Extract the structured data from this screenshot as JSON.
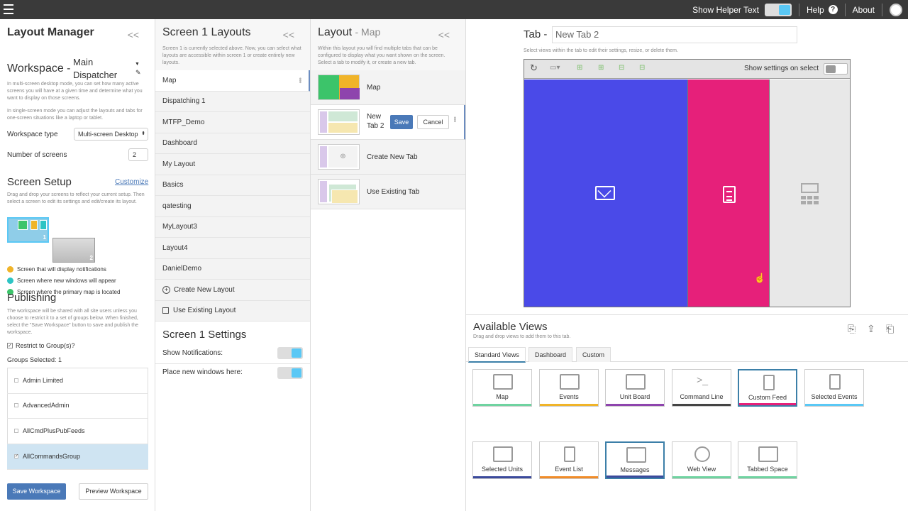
{
  "topbar": {
    "helper_label": "Show Helper Text",
    "help_label": "Help",
    "about_label": "About"
  },
  "layout_manager": {
    "title": "Layout Manager",
    "workspace_label": "Workspace -",
    "workspace_name": "Main Dispatcher",
    "desc1": "In multi-screen desktop mode, you can set how many active screens you will have at a given time and determine what you want to display on those screens.",
    "desc2": "In single-screen mode you can adjust the layouts and tabs for one-screen situations like a laptop or tablet.",
    "workspace_type_label": "Workspace type",
    "workspace_type_value": "Multi-screen Desktop",
    "num_screens_label": "Number of screens",
    "num_screens_value": "2",
    "screen_setup_title": "Screen Setup",
    "customize_label": "Customize",
    "screen_setup_desc": "Drag and drop your screens to reflect your current setup. Then select a screen to edit its settings and edit/create its layout.",
    "screen1_num": "1",
    "screen2_num": "2",
    "legend": [
      {
        "label": "Screen that will display notifications",
        "color": "#f0b429"
      },
      {
        "label": "Screen where new windows will appear",
        "color": "#2ec4c4"
      },
      {
        "label": "Screen where the primary map is located",
        "color": "#3cc46a"
      }
    ],
    "publishing_title": "Publishing",
    "publishing_desc": "The workspace will be shared with all site users unless you choose to restrict it to a set of groups below. When finished, select the \"Save Workspace\" button to save and publish the workspace.",
    "restrict_label": "Restrict to Group(s)?",
    "groups_selected_label": "Groups Selected: 1",
    "groups": [
      "Admin Limited",
      "AdvancedAdmin",
      "AllCmdPlusPubFeeds",
      "AllCommandsGroup"
    ],
    "save_label": "Save Workspace",
    "preview_label": "Preview Workspace"
  },
  "screen_layouts": {
    "title": "Screen 1 Layouts",
    "desc": "Screen 1 is currently selected above. Now, you can select what layouts are accessible within screen 1 or create entirely new layouts.",
    "items": [
      "Map",
      "Dispatching 1",
      "MTFP_Demo",
      "Dashboard",
      "My Layout",
      "Basics",
      "qatesting",
      "MyLayout3",
      "Layout4",
      "DanielDemo"
    ],
    "create_label": "Create New Layout",
    "use_existing_label": "Use Existing Layout",
    "settings_title": "Screen 1 Settings",
    "show_notifications_label": "Show Notifications:",
    "place_windows_label": "Place new windows here:"
  },
  "layout_map": {
    "title": "Layout",
    "subtitle": "- Map",
    "desc": "Within this layout you will find multiple tabs that can be configured to display what you want shown on the screen. Select a tab to modify it, or create a new tab.",
    "tab_map_label": "Map",
    "tab_new_label": "New Tab 2",
    "save_label": "Save",
    "cancel_label": "Cancel",
    "create_tab_label": "Create New Tab",
    "use_existing_tab_label": "Use Existing Tab"
  },
  "tab_editor": {
    "tab_label": "Tab -",
    "tab_name_value": "New Tab 2",
    "desc": "Select views within the tab to edit their settings, resize, or delete them.",
    "show_settings_label": "Show settings on select",
    "colors": {
      "blue": "#4a4ae8",
      "pink": "#e6207a",
      "gray": "#e8e8e8"
    }
  },
  "available_views": {
    "title": "Available Views",
    "desc": "Drag and drop views to add them to this tab.",
    "tabs": [
      "Standard Views",
      "Dashboard",
      "Custom"
    ],
    "views": [
      {
        "name": "Map",
        "color": "#6fd3a0"
      },
      {
        "name": "Events",
        "color": "#f0b429"
      },
      {
        "name": "Unit Board",
        "color": "#8e44ad"
      },
      {
        "name": "Command Line",
        "color": "#444444"
      },
      {
        "name": "Custom Feed",
        "color": "#e6207a"
      },
      {
        "name": "Selected Events",
        "color": "#5ac8f5"
      },
      {
        "name": "Selected Units",
        "color": "#3b4a9c"
      },
      {
        "name": "Event List",
        "color": "#f08c29"
      },
      {
        "name": "Messages",
        "color": "#3b4a9c"
      },
      {
        "name": "Web View",
        "color": "#6fd3a0"
      },
      {
        "name": "Tabbed Space",
        "color": "#6fd3a0"
      }
    ]
  }
}
